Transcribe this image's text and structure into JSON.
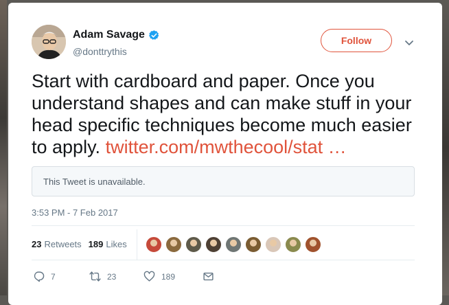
{
  "author": {
    "name": "Adam Savage",
    "handle": "@donttrythis",
    "verified": true
  },
  "follow_label": "Follow",
  "tweet": {
    "text": "Start with cardboard and paper. Once you understand shapes and can make stuff in your head specific techniques become much easier to apply. ",
    "link": "twitter.com/mwthecool/stat …",
    "link_color": "#e0533b"
  },
  "quoted": {
    "text": "This Tweet is unavailable."
  },
  "timestamp": "3:53 PM - 7 Feb 2017",
  "stats": {
    "retweets_count": "23",
    "retweets_label": "Retweets",
    "likes_count": "189",
    "likes_label": "Likes"
  },
  "liker_avatar_colors": [
    "#c64a3a",
    "#8b6a3e",
    "#5e5a4a",
    "#4e4034",
    "#6f7674",
    "#7a5c32",
    "#d9c7b8",
    "#8a8a4e",
    "#a0522d"
  ],
  "actions": {
    "reply_count": "7",
    "retweet_count": "23",
    "like_count": "189"
  },
  "icons": [
    "verified-icon",
    "chevron-down-icon",
    "reply-icon",
    "retweet-icon",
    "heart-icon",
    "mail-icon"
  ]
}
